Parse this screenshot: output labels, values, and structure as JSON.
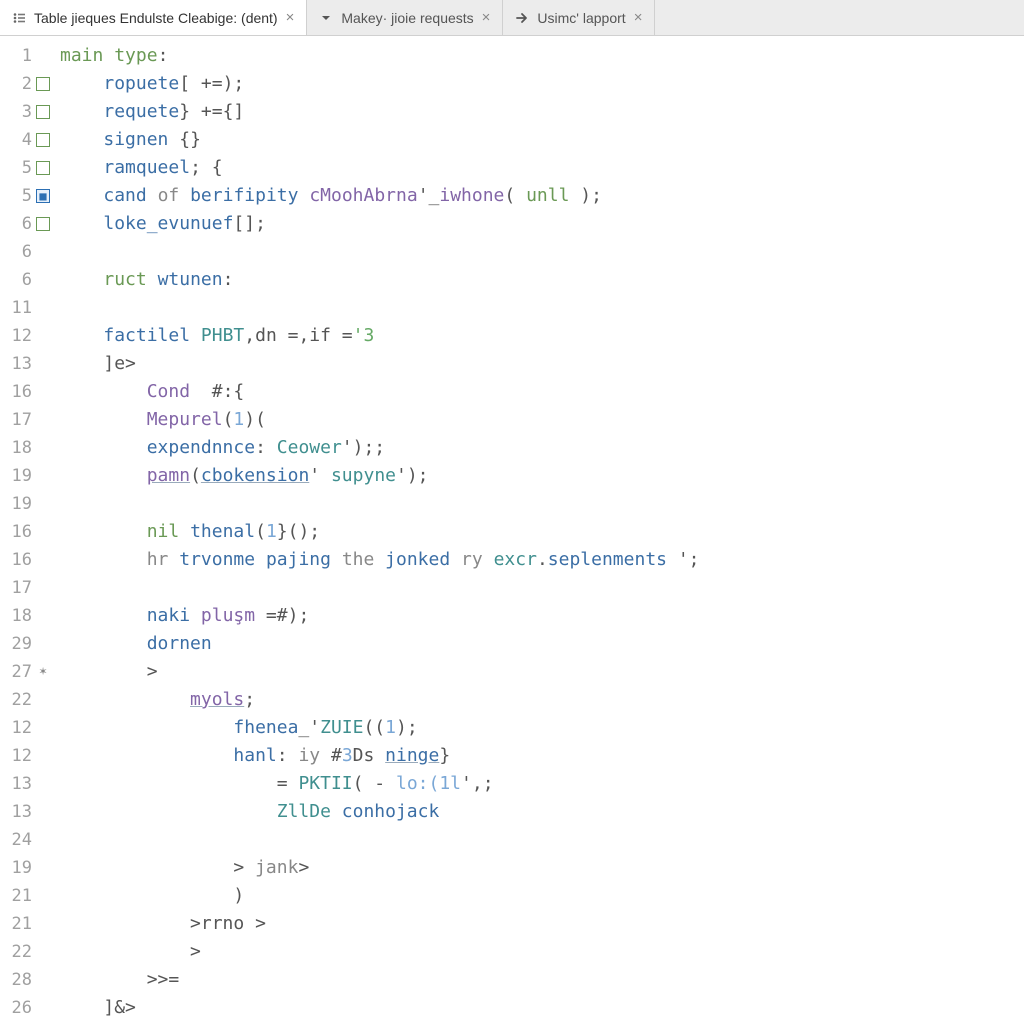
{
  "tabs": [
    {
      "label": "Table jieques Endulste Cleabige: (dent)",
      "icon": "tab-icon-bullets",
      "active": true
    },
    {
      "label": "Makey· jioie requests",
      "icon": "tab-icon-caret-down",
      "active": false
    },
    {
      "label": "Usimc' lapport",
      "icon": "tab-icon-arrow-right",
      "active": false
    }
  ],
  "close_glyph": "×",
  "lines": [
    {
      "num": "1",
      "glyph": "",
      "indent": 0,
      "segs": [
        [
          "kw",
          "main"
        ],
        [
          "pun",
          " "
        ],
        [
          "kw",
          "type"
        ],
        [
          "pun",
          ":"
        ]
      ]
    },
    {
      "num": "2",
      "glyph": "sq-green",
      "indent": 1,
      "segs": [
        [
          "id",
          "ropuete"
        ],
        [
          "pun",
          "[ +=);"
        ]
      ]
    },
    {
      "num": "3",
      "glyph": "sq-green",
      "indent": 1,
      "segs": [
        [
          "id",
          "requete"
        ],
        [
          "pun",
          "} +={]"
        ]
      ]
    },
    {
      "num": "4",
      "glyph": "sq-green",
      "indent": 1,
      "segs": [
        [
          "id",
          "signen"
        ],
        [
          "pun",
          " {}"
        ]
      ]
    },
    {
      "num": "5",
      "glyph": "sq-green",
      "indent": 1,
      "segs": [
        [
          "id",
          "ramqueel"
        ],
        [
          "pun",
          "; {"
        ]
      ]
    },
    {
      "num": "5",
      "glyph": "sq-blue",
      "indent": 1,
      "segs": [
        [
          "id",
          "cand"
        ],
        [
          "pun",
          " "
        ],
        [
          "dim",
          "of"
        ],
        [
          "pun",
          " "
        ],
        [
          "id",
          "berifipity"
        ],
        [
          "pun",
          " "
        ],
        [
          "fn",
          "cMoohAbrna"
        ],
        [
          "pun",
          "'_"
        ],
        [
          "fn",
          "iwhone"
        ],
        [
          "pun",
          "( "
        ],
        [
          "kw",
          "unll"
        ],
        [
          "pun",
          " );"
        ]
      ]
    },
    {
      "num": "6",
      "glyph": "sq-green",
      "indent": 1,
      "segs": [
        [
          "id",
          "loke_evunuef"
        ],
        [
          "pun",
          "[];"
        ]
      ]
    },
    {
      "num": "6",
      "glyph": "",
      "indent": 0,
      "segs": [
        [
          "pun",
          ""
        ]
      ]
    },
    {
      "num": "6",
      "glyph": "",
      "indent": 1,
      "segs": [
        [
          "kw",
          "ruct"
        ],
        [
          "pun",
          " "
        ],
        [
          "id",
          "wtunen"
        ],
        [
          "pun",
          ":"
        ]
      ]
    },
    {
      "num": "11",
      "glyph": "",
      "indent": 0,
      "segs": [
        [
          "pun",
          ""
        ]
      ]
    },
    {
      "num": "12",
      "glyph": "",
      "indent": 1,
      "segs": [
        [
          "id",
          "factilel"
        ],
        [
          "pun",
          " "
        ],
        [
          "cls",
          "PHBT"
        ],
        [
          "pun",
          ",dn =,if ="
        ],
        [
          "num",
          "'3"
        ]
      ]
    },
    {
      "num": "13",
      "glyph": "",
      "indent": 1,
      "segs": [
        [
          "pun",
          "]e>"
        ]
      ]
    },
    {
      "num": "16",
      "glyph": "",
      "indent": 2,
      "segs": [
        [
          "fn",
          "Cond"
        ],
        [
          "pun",
          "  #:{"
        ]
      ]
    },
    {
      "num": "17",
      "glyph": "",
      "indent": 2,
      "segs": [
        [
          "fn",
          "Mepurel"
        ],
        [
          "pun",
          "("
        ],
        [
          "idlt",
          "1"
        ],
        [
          "pun",
          ")("
        ]
      ]
    },
    {
      "num": "18",
      "glyph": "",
      "indent": 2,
      "segs": [
        [
          "id",
          "expendnnce"
        ],
        [
          "pun",
          ": "
        ],
        [
          "cls",
          "Ceower"
        ],
        [
          "pun",
          "');;"
        ]
      ]
    },
    {
      "num": "19",
      "glyph": "",
      "indent": 2,
      "segs": [
        [
          "fn u",
          "pamn"
        ],
        [
          "pun",
          "("
        ],
        [
          "id u",
          "cbokension"
        ],
        [
          "pun",
          "' "
        ],
        [
          "cls",
          "supyne"
        ],
        [
          "pun",
          "');"
        ]
      ]
    },
    {
      "num": "19",
      "glyph": "",
      "indent": 0,
      "segs": [
        [
          "pun",
          ""
        ]
      ]
    },
    {
      "num": "16",
      "glyph": "",
      "indent": 2,
      "segs": [
        [
          "kw",
          "nil"
        ],
        [
          "pun",
          " "
        ],
        [
          "id",
          "thenal"
        ],
        [
          "pun",
          "("
        ],
        [
          "idlt",
          "1"
        ],
        [
          "pun",
          "}();"
        ]
      ]
    },
    {
      "num": "16",
      "glyph": "",
      "indent": 2,
      "segs": [
        [
          "dim",
          "hr"
        ],
        [
          "pun",
          " "
        ],
        [
          "id",
          "trvonme"
        ],
        [
          "pun",
          " "
        ],
        [
          "id",
          "pajing"
        ],
        [
          "pun",
          " "
        ],
        [
          "dim",
          "the"
        ],
        [
          "pun",
          " "
        ],
        [
          "id",
          "jonked"
        ],
        [
          "pun",
          " "
        ],
        [
          "dim",
          "ry"
        ],
        [
          "pun",
          " "
        ],
        [
          "cls",
          "excr"
        ],
        [
          "pun",
          "."
        ],
        [
          "id",
          "seplenments"
        ],
        [
          "pun",
          " ';"
        ]
      ]
    },
    {
      "num": "17",
      "glyph": "",
      "indent": 0,
      "segs": [
        [
          "pun",
          ""
        ]
      ]
    },
    {
      "num": "18",
      "glyph": "",
      "indent": 2,
      "segs": [
        [
          "id",
          "naki"
        ],
        [
          "pun",
          " "
        ],
        [
          "fn",
          "pluşm"
        ],
        [
          "pun",
          " =#);"
        ]
      ]
    },
    {
      "num": "29",
      "glyph": "",
      "indent": 2,
      "segs": [
        [
          "id",
          "dornen"
        ]
      ]
    },
    {
      "num": "27",
      "glyph": "asterisk",
      "indent": 2,
      "segs": [
        [
          "pun",
          ">"
        ]
      ]
    },
    {
      "num": "22",
      "glyph": "",
      "indent": 3,
      "segs": [
        [
          "fn u",
          "myols"
        ],
        [
          "pun",
          ";"
        ]
      ]
    },
    {
      "num": "12",
      "glyph": "",
      "indent": 4,
      "segs": [
        [
          "id",
          "fhenea"
        ],
        [
          "pun",
          "_'"
        ],
        [
          "cls",
          "ZUIE"
        ],
        [
          "pun",
          "(("
        ],
        [
          "idlt",
          "1"
        ],
        [
          "pun",
          ");"
        ]
      ]
    },
    {
      "num": "12",
      "glyph": "",
      "indent": 4,
      "segs": [
        [
          "id",
          "hanl"
        ],
        [
          "pun",
          ": "
        ],
        [
          "dim",
          "iy"
        ],
        [
          "pun",
          " #"
        ],
        [
          "idlt",
          "3"
        ],
        [
          "pun",
          "Ds "
        ],
        [
          "id u",
          "ninge"
        ],
        [
          "pun",
          "}"
        ]
      ]
    },
    {
      "num": "13",
      "glyph": "",
      "indent": 5,
      "segs": [
        [
          "pun",
          "= "
        ],
        [
          "cls",
          "PKTII"
        ],
        [
          "pun",
          "( - "
        ],
        [
          "idlt",
          "lo:(1l"
        ],
        [
          "pun",
          "',;"
        ]
      ]
    },
    {
      "num": "13",
      "glyph": "",
      "indent": 5,
      "segs": [
        [
          "cls",
          "ZllDe"
        ],
        [
          "pun",
          " "
        ],
        [
          "id",
          "conhojack"
        ]
      ]
    },
    {
      "num": "24",
      "glyph": "",
      "indent": 0,
      "segs": [
        [
          "pun",
          ""
        ]
      ]
    },
    {
      "num": "19",
      "glyph": "",
      "indent": 4,
      "segs": [
        [
          "pun",
          "> "
        ],
        [
          "dim",
          "jank"
        ],
        [
          "pun",
          ">"
        ]
      ]
    },
    {
      "num": "21",
      "glyph": "",
      "indent": 4,
      "segs": [
        [
          "pun",
          ")"
        ]
      ]
    },
    {
      "num": "21",
      "glyph": "",
      "indent": 3,
      "segs": [
        [
          "pun",
          ">rrno >"
        ]
      ]
    },
    {
      "num": "22",
      "glyph": "",
      "indent": 3,
      "segs": [
        [
          "pun",
          ">"
        ]
      ]
    },
    {
      "num": "28",
      "glyph": "",
      "indent": 2,
      "segs": [
        [
          "pun",
          ">>="
        ]
      ]
    },
    {
      "num": "26",
      "glyph": "",
      "indent": 1,
      "segs": [
        [
          "pun",
          "]&>"
        ]
      ]
    }
  ]
}
